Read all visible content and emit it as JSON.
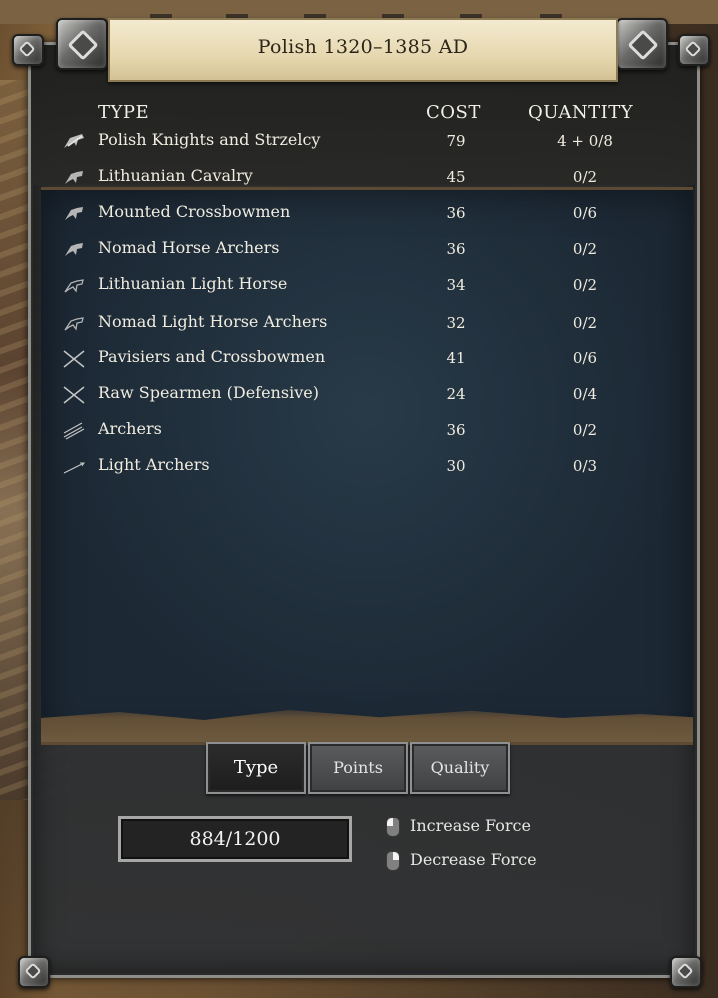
{
  "header": {
    "title": "Polish 1320–1385 AD"
  },
  "table": {
    "columns": {
      "type": "TYPE",
      "cost": "COST",
      "quantity": "QUANTITY"
    },
    "rows": [
      {
        "icon": "heavy-cavalry-icon",
        "name": "Polish Knights and Strzelcy",
        "cost": "79",
        "quantity": "4 + 0/8"
      },
      {
        "icon": "cavalry-icon",
        "name": "Lithuanian Cavalry",
        "cost": "45",
        "quantity": "0/2"
      },
      {
        "icon": "cavalry-icon",
        "name": "Mounted Crossbowmen",
        "cost": "36",
        "quantity": "0/6"
      },
      {
        "icon": "cavalry-icon",
        "name": "Nomad Horse Archers",
        "cost": "36",
        "quantity": "0/2"
      },
      {
        "icon": "light-horse-icon",
        "name": "Lithuanian Light Horse",
        "cost": "34",
        "quantity": "0/2"
      },
      {
        "icon": "light-horse-icon",
        "name": "Nomad Light Horse Archers",
        "cost": "32",
        "quantity": "0/2"
      },
      {
        "icon": "crossed-spears-icon",
        "name": "Pavisiers and Crossbowmen",
        "cost": "41",
        "quantity": "0/6"
      },
      {
        "icon": "crossed-spears-icon",
        "name": "Raw Spearmen (Defensive)",
        "cost": "24",
        "quantity": "0/4"
      },
      {
        "icon": "arrows-icon",
        "name": "Archers",
        "cost": "36",
        "quantity": "0/2"
      },
      {
        "icon": "single-arrow-icon",
        "name": "Light Archers",
        "cost": "30",
        "quantity": "0/3"
      }
    ]
  },
  "tabs": [
    {
      "label": "Type",
      "active": true
    },
    {
      "label": "Points",
      "active": false
    },
    {
      "label": "Quality",
      "active": false
    }
  ],
  "points": {
    "value": "884/1200"
  },
  "hints": {
    "increase": {
      "icon": "mouse-left-icon",
      "label": "Increase Force"
    },
    "decrease": {
      "icon": "mouse-right-icon",
      "label": "Decrease Force"
    }
  },
  "colors": {
    "panel": "#2e3032",
    "map": "#233140",
    "banner": "#e6d8b0",
    "text": "#f0ece0"
  }
}
